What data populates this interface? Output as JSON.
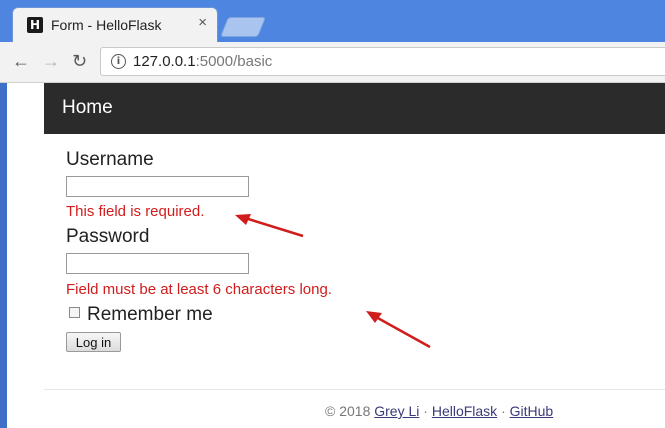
{
  "browser": {
    "tab_title": "Form - HelloFlask",
    "favicon_letter": "H",
    "close_glyph": "×",
    "url_host": "127.0.0.1",
    "url_rest": ":5000/basic",
    "info_glyph": "i",
    "back_glyph": "←",
    "forward_glyph": "→",
    "reload_glyph": "↻"
  },
  "navbar": {
    "brand": "Home"
  },
  "form": {
    "username_label": "Username",
    "username_value": "",
    "username_error": "This field is required.",
    "password_label": "Password",
    "password_value": "",
    "password_error": "Field must be at least 6 characters long.",
    "remember_label": "Remember me",
    "remember_checked": false,
    "submit_label": "Log in"
  },
  "footer": {
    "prefix": "© 2018",
    "author": "Grey Li",
    "sep1": "·",
    "project": "HelloFlask",
    "sep2": "·",
    "repo": "GitHub"
  },
  "colors": {
    "error": "#d11c1c",
    "arrow": "#d11c1c",
    "navbar_bg": "#2b2b2b",
    "tabstrip_bg": "#4d85e0"
  }
}
